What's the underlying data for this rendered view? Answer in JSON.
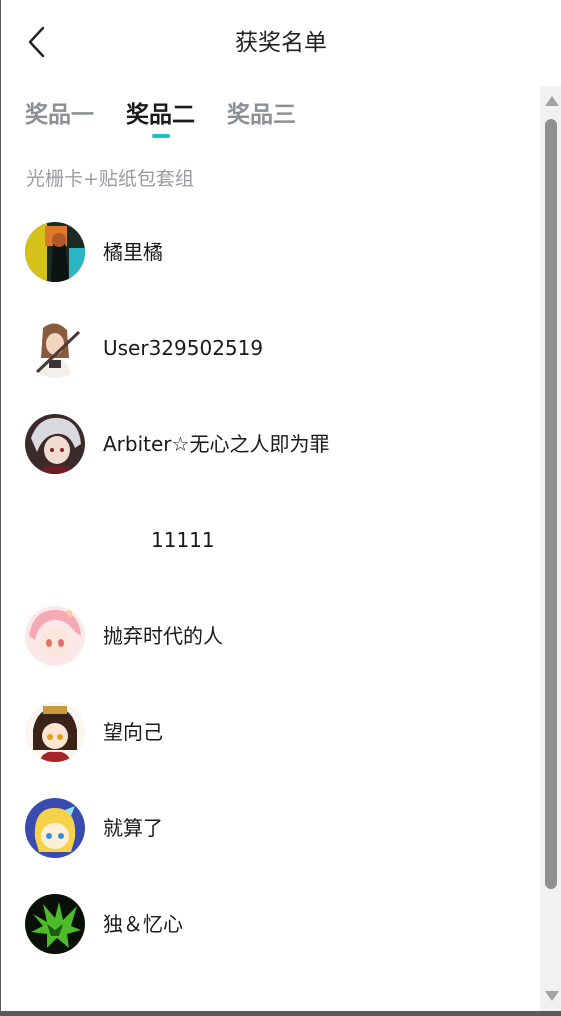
{
  "header": {
    "title": "获奖名单",
    "back_icon": "chevron-left-icon"
  },
  "tabs": [
    {
      "label": "奖品一",
      "active": false
    },
    {
      "label": "奖品二",
      "active": true
    },
    {
      "label": "奖品三",
      "active": false
    }
  ],
  "accent_color": "#16c8c0",
  "prize": {
    "description": "光栅卡+贴纸包套组"
  },
  "winners": [
    {
      "name": "橘里橘",
      "avatar": "avatar-icon"
    },
    {
      "name": "User329502519",
      "avatar": "avatar-icon"
    },
    {
      "name": "Arbiter☆无心之人即为罪",
      "avatar": "avatar-icon"
    },
    {
      "name": "11111",
      "avatar": null
    },
    {
      "name": "抛弃时代的人",
      "avatar": "avatar-icon"
    },
    {
      "name": "望向己",
      "avatar": "avatar-icon"
    },
    {
      "name": "就算了",
      "avatar": "avatar-icon"
    },
    {
      "name": "独＆忆心",
      "avatar": "avatar-icon"
    }
  ]
}
